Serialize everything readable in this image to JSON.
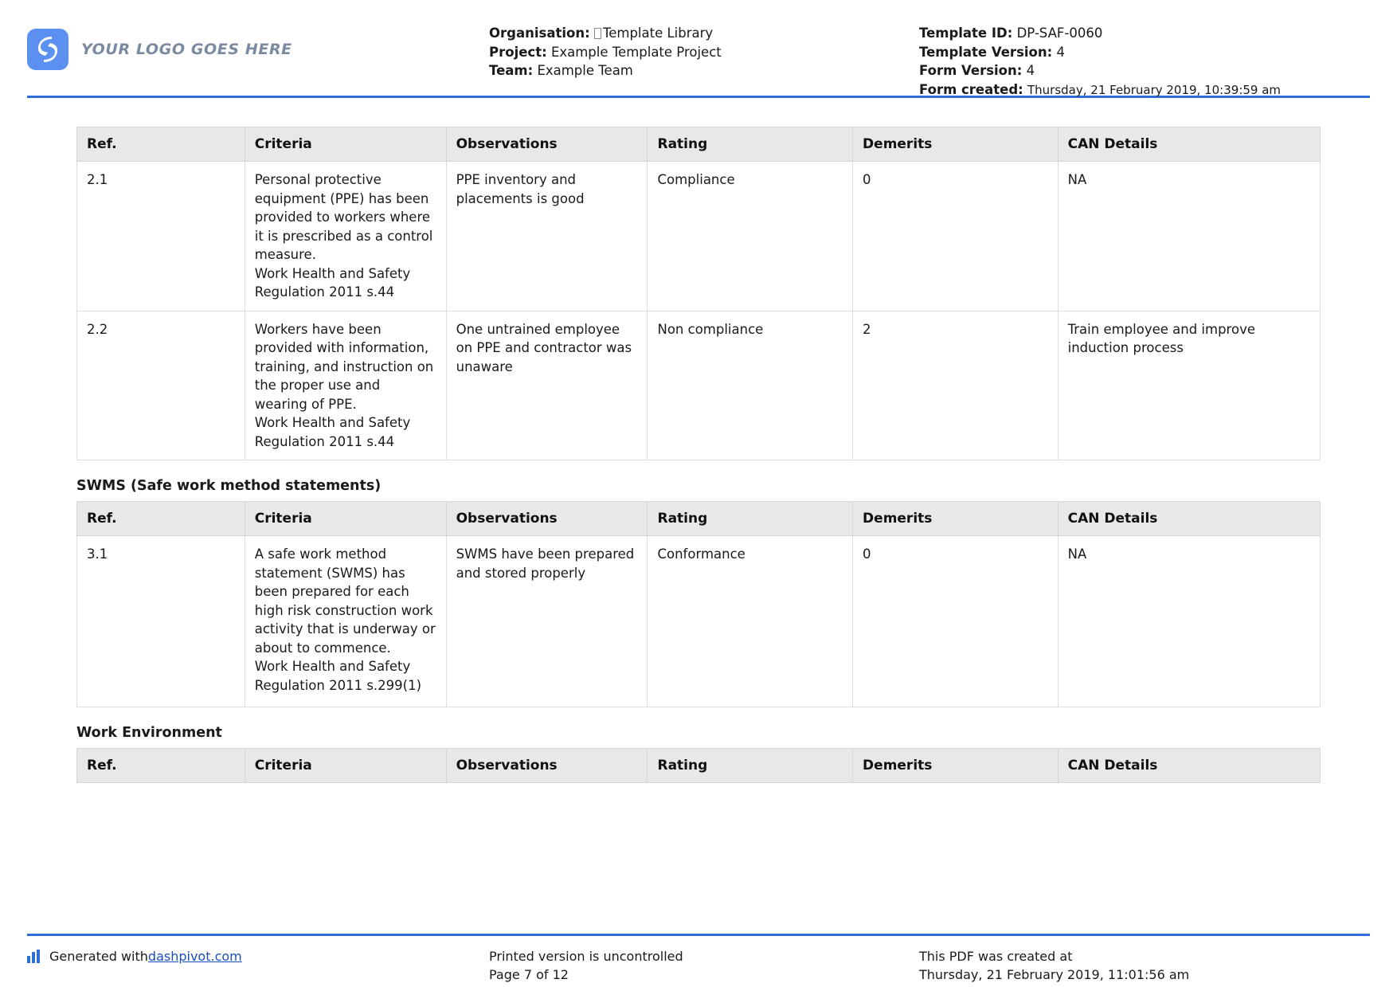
{
  "header": {
    "logo_text": "YOUR LOGO GOES HERE",
    "logo_icon": "dashpivot-s-logo-icon",
    "left_meta": [
      {
        "label": "Organisation:",
        "value": "Template Library",
        "has_missing_glyph": true
      },
      {
        "label": "Project:",
        "value": "Example Template Project",
        "has_missing_glyph": false
      },
      {
        "label": "Team:",
        "value": "Example Team",
        "has_missing_glyph": false
      }
    ],
    "right_meta": [
      {
        "label": "Template ID:",
        "value": "DP-SAF-0060"
      },
      {
        "label": "Template Version:",
        "value": "4"
      },
      {
        "label": "Form Version:",
        "value": "4"
      },
      {
        "label": "Form created:",
        "value": "Thursday, 21 February 2019, 10:39:59 am"
      }
    ],
    "accent_color": "#2d6fd6"
  },
  "columns": {
    "ref": "Ref.",
    "criteria": "Criteria",
    "observations": "Observations",
    "rating": "Rating",
    "demerits": "Demerits",
    "can_details": "CAN Details"
  },
  "sections": [
    {
      "title": "",
      "rows": [
        {
          "ref": "2.1",
          "criteria": "Personal protective equipment (PPE) has been provided to workers where it is prescribed as a control measure.",
          "criteria_reg": "Work Health and Safety Regulation 2011 s.44",
          "observations": "PPE inventory and placements is good",
          "rating": "Compliance",
          "demerits": "0",
          "can_details": "NA"
        },
        {
          "ref": "2.2",
          "criteria": "Workers have been provided with information, training, and instruction on the proper use and wearing of PPE.",
          "criteria_reg": "Work Health and Safety Regulation 2011 s.44",
          "observations": "One untrained employee on PPE and contractor was unaware",
          "rating": "Non compliance",
          "demerits": "2",
          "can_details": "Train employee and improve induction process"
        }
      ]
    },
    {
      "title": "SWMS (Safe work method statements)",
      "rows": [
        {
          "ref": "3.1",
          "criteria": "A safe work method statement (SWMS) has been prepared for each high risk construction work activity that is underway or about to commence.",
          "criteria_reg": "Work Health and Safety Regulation 2011 s.299(1)",
          "observations": "SWMS have been prepared and stored properly",
          "rating": "Conformance",
          "demerits": "0",
          "can_details": "NA"
        }
      ]
    },
    {
      "title": "Work Environment",
      "rows": []
    }
  ],
  "footer": {
    "generated_prefix": "Generated with ",
    "generated_link": "dashpivot.com",
    "uncontrolled_text": "Printed version is uncontrolled",
    "page_text": "Page 7 of 12",
    "created_at_label": "This PDF was created at",
    "created_at_value": "Thursday, 21 February 2019, 11:01:56 am",
    "bars_icon": "bar-chart-icon"
  }
}
